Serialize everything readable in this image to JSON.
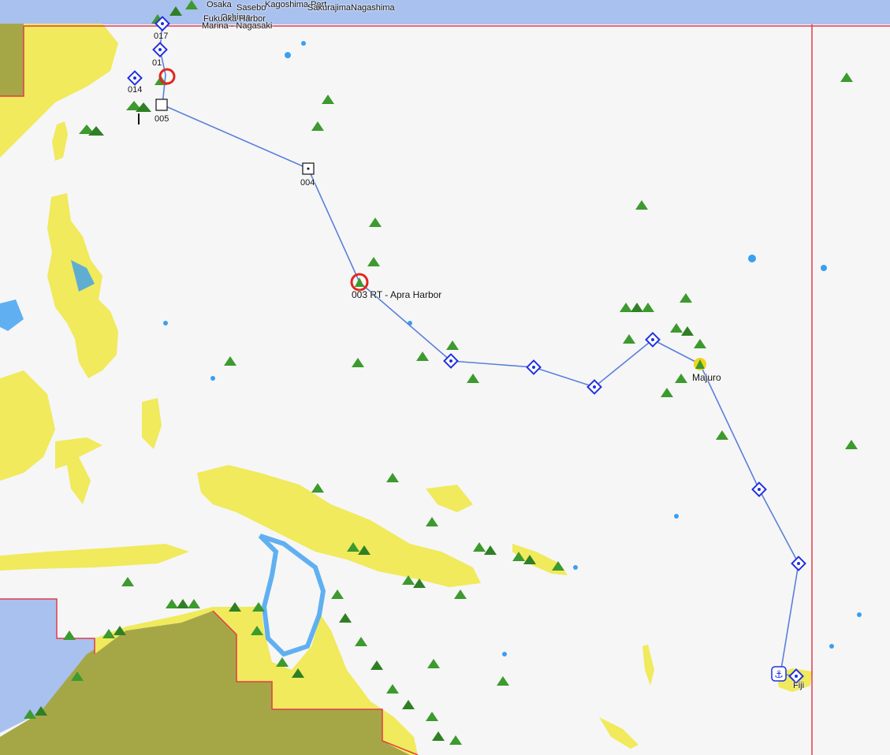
{
  "colors": {
    "sea": "#f6f6f6",
    "deep_water": "#a9c1ee",
    "land_yellow": "#f0ea5c",
    "land_olive": "#a5a747",
    "shallow_blue": "#3b9ff0",
    "route": "#5a7fdc",
    "waypoint": "#1f2fe0",
    "boundary": "#e23b4b",
    "current_position": "#e0271e"
  },
  "waypoints": [
    "017",
    "01",
    "014",
    "005",
    "004",
    "003",
    "Majuro",
    "Fiji"
  ],
  "places": {
    "nagasaki_marina": "Marina - Nagasaki",
    "apra_harbor": "RT - Apra Harbor",
    "majuro": "Majuro",
    "fiji": "Fiji",
    "top_cluster_1": "Kagoshima Port",
    "top_cluster_2": "Sakurajima",
    "top_cluster_3": "Nagashima",
    "top_cluster_4": "Oshima",
    "top_cluster_5": "Sasebo",
    "top_cluster_6": "Fukuoka Harbor",
    "top_cluster_7": "Osaka"
  },
  "icons": {
    "anchor": "anchor-icon",
    "waypoint": "waypoint-diamond-icon",
    "island": "island-marker-icon",
    "position": "current-position-icon"
  }
}
